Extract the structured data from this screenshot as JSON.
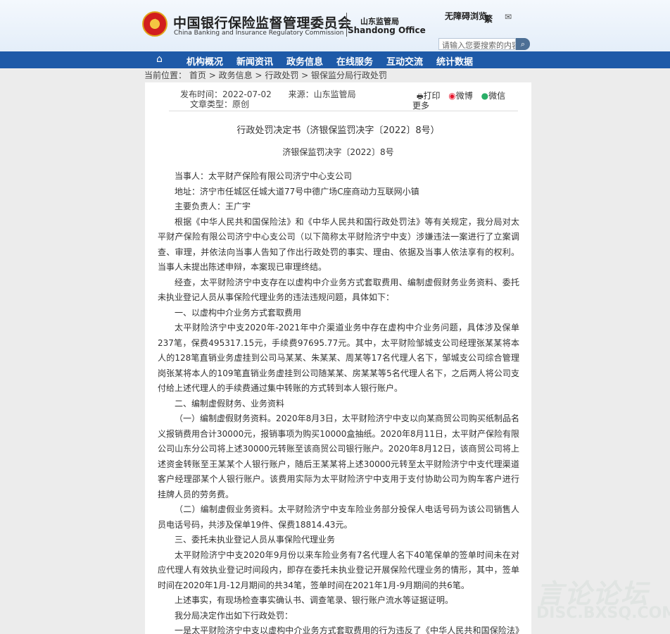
{
  "header": {
    "org_cn": "中国银行保险监督管理委员会",
    "org_en": "China Banking and Insurance Regulatory Commission",
    "branch_cn": "山东监管局",
    "branch_en": "Shandong Office",
    "accessibility": "无障碍浏览",
    "traditional": "繁",
    "mail_icon": "envelope-icon",
    "search_placeholder": "请输入您要搜索的内容",
    "search_icon": "search-icon",
    "emblem_icon": "national-emblem-icon"
  },
  "nav": {
    "home_icon": "home-icon",
    "items": [
      "机构概况",
      "新闻资讯",
      "政务信息",
      "在线服务",
      "互动交流",
      "统计数据"
    ]
  },
  "breadcrumb": {
    "label": "当前位置：",
    "path": [
      "首页",
      "政务信息",
      "行政处罚",
      "银保监分局行政处罚"
    ],
    "sep": ">"
  },
  "article": {
    "publish_time": "发布时间：2022-07-02",
    "source": "来源：山东监管局",
    "doc_type": "文章类型：原创",
    "share": {
      "print": "打印",
      "weibo": "微博",
      "wechat": "微信",
      "more": "更多"
    },
    "title": "行政处罚决定书（济银保监罚决字〔2022〕8号）",
    "number": "济银保监罚决字〔2022〕8号",
    "paragraphs": [
      "当事人：太平财产保险有限公司济宁中心支公司",
      "地址：济宁市任城区任城大道77号中德广场C座商动力互联网小镇",
      "主要负责人：王广宇",
      "根据《中华人民共和国保险法》和《中华人民共和国行政处罚法》等有关规定，我分局对太平财产保险有限公司济宁中心支公司（以下简称太平财险济宁中支）涉嫌违法一案进行了立案调查、审理，并依法向当事人告知了作出行政处罚的事实、理由、依据及当事人依法享有的权利。当事人未提出陈述申辩，本案现已审理终结。",
      "经查，太平财险济宁中支存在以虚构中介业务方式套取费用、编制虚假财务业务资料、委托未执业登记人员从事保险代理业务的违法违规问题，具体如下：",
      "一、以虚构中介业务方式套取费用",
      "太平财险济宁中支2020年-2021年中介渠道业务中存在虚构中介业务问题，具体涉及保单237笔，保费495317.15元，手续费97695.77元。其中，太平财险邹城支公司经理张某某将本人的128笔直销业务虚挂到公司马某某、朱某某、周某等17名代理人名下，邹城支公司综合管理岗张某将本人的109笔直销业务虚挂到公司随某某、房某某等5名代理人名下，之后两人将公司支付给上述代理人的手续费通过集中转账的方式转到本人银行账户。",
      "二、编制虚假财务、业务资料",
      "（一）编制虚假财务资料。2020年8月3日，太平财险济宁中支以向某商贸公司购买纸制品名义报销费用合计30000元，报销事项为购买10000盒抽纸。2020年8月11日，太平财产保险有限公司山东分公司将上述30000元转账至该商贸公司银行账户。2020年8月12日，该商贸公司将上述资金转账至王某某个人银行账户，随后王某某将上述30000元转至太平财险济宁中支代理渠道客户经理邵某个人银行账户。该费用实际为太平财险济宁中支用于支付协助公司为购车客户进行挂牌人员的劳务费。",
      "（二）编制虚假业务资料。太平财险济宁中支车险业务部分投保人电话号码为该公司销售人员电话号码，共涉及保单19件、保费18814.43元。",
      "三、委托未执业登记人员从事保险代理业务",
      "太平财险济宁中支2020年9月份以来车险业务有7名代理人名下40笔保单的签单时间未在对应代理人有效执业登记时间段内，即存在委托未执业登记开展保险代理业务的情形，其中，签单时间在2020年1月-12月期间的共34笔，签单时间在2021年1月-9月期间的共6笔。",
      "上述事实，有现场检查事实确认书、调查笔录、银行账户流水等证据证明。",
      "我分局决定作出如下行政处罚：",
      "一是太平财险济宁中支以虚构中介业务方式套取费用的行为违反了《中华人民共和国保险法》第一百一十六条第十项，根据《中华人民共和国保险法》第一百六十一条，我分局决定给予"
    ]
  },
  "watermark": {
    "line1": "言论论坛",
    "line2": "DISC.BXSQ.COM"
  }
}
